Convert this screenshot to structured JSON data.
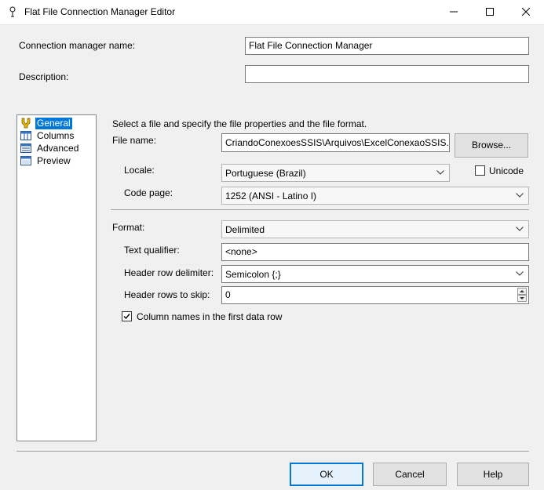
{
  "window": {
    "title": "Flat File Connection Manager Editor",
    "minimize": "—",
    "maximize": "☐",
    "close": "✕"
  },
  "header": {
    "name_label": "Connection manager name:",
    "name_value": "Flat File Connection Manager",
    "description_label": "Description:",
    "description_value": ""
  },
  "nav": {
    "items": [
      {
        "label": "General",
        "icon": "general-icon",
        "selected": true
      },
      {
        "label": "Columns",
        "icon": "columns-icon",
        "selected": false
      },
      {
        "label": "Advanced",
        "icon": "advanced-icon",
        "selected": false
      },
      {
        "label": "Preview",
        "icon": "preview-icon",
        "selected": false
      }
    ]
  },
  "general": {
    "intro": "Select a file and specify the file properties and the file format.",
    "file_name_label": "File name:",
    "file_name_value": "CriandoConexoesSSIS\\Arquivos\\ExcelConexaoSSIS.csv",
    "browse_label": "Browse...",
    "locale_label": "Locale:",
    "locale_value": "Portuguese (Brazil)",
    "unicode_label": "Unicode",
    "unicode_checked": false,
    "codepage_label": "Code page:",
    "codepage_value": "1252  (ANSI - Latino I)",
    "format_label": "Format:",
    "format_value": "Delimited",
    "text_qualifier_label": "Text qualifier:",
    "text_qualifier_value": "<none>",
    "header_row_delim_label": "Header row delimiter:",
    "header_row_delim_value": "Semicolon {;}",
    "header_rows_skip_label": "Header rows to skip:",
    "header_rows_skip_value": "0",
    "column_names_label": "Column names in the first data row",
    "column_names_checked": true
  },
  "footer": {
    "ok_label": "OK",
    "cancel_label": "Cancel",
    "help_label": "Help"
  },
  "colors": {
    "accent": "#0078d7",
    "selection": "#0078d7"
  }
}
